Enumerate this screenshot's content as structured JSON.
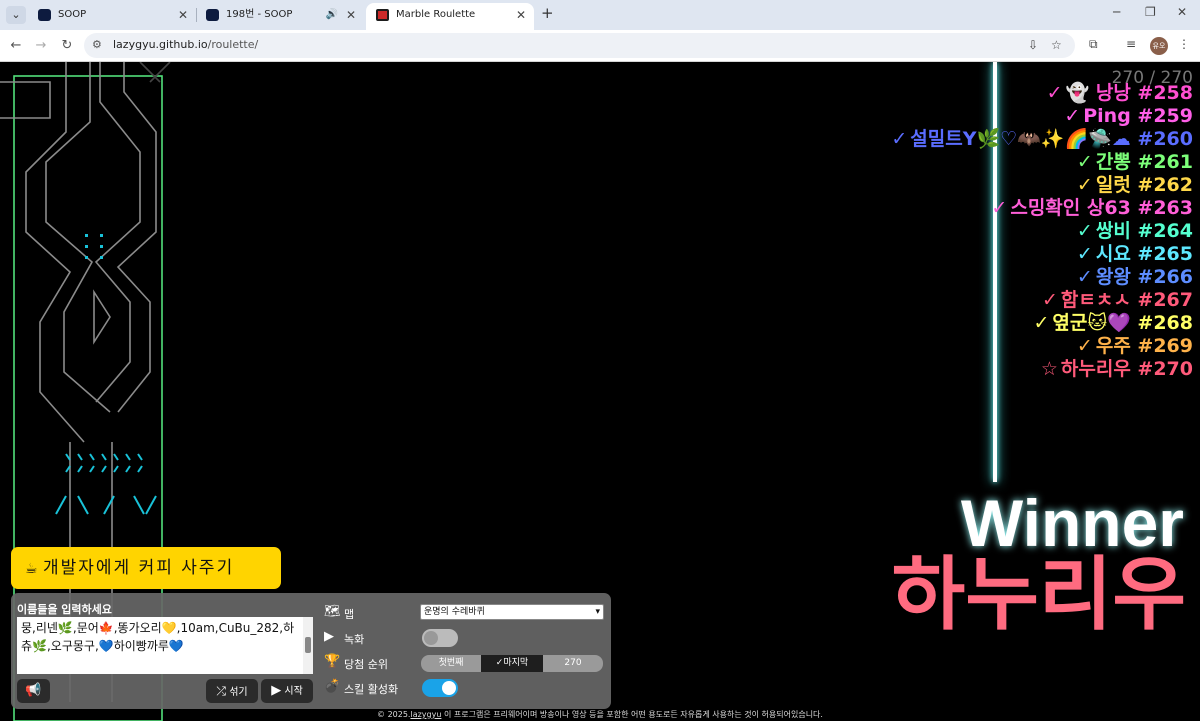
{
  "browser": {
    "tabs": [
      {
        "title": "SOOP",
        "active": false
      },
      {
        "title": "198번 - SOOP",
        "active": false,
        "audio": true
      },
      {
        "title": "Marble Roulette",
        "active": true
      }
    ],
    "url_host": "lazygyu.github.io",
    "url_path": "/roulette/",
    "avatar": "유오"
  },
  "game": {
    "counter": "270 / 270",
    "ranking": [
      {
        "mark": "✓",
        "text": "👻 낭낭 #258",
        "color": "#ff4fd1"
      },
      {
        "mark": "✓",
        "text": "Ping #259",
        "color": "#ff5fe8"
      },
      {
        "mark": "✓",
        "text": "설밀트Y🌿♡🦇✨🌈🛸☁ #260",
        "color": "#5a6dff"
      },
      {
        "mark": "✓",
        "text": "간뽕 #261",
        "color": "#7dff7a"
      },
      {
        "mark": "✓",
        "text": "일럿 #262",
        "color": "#ffd84a"
      },
      {
        "mark": "✓",
        "text": "스밍확인 상63 #263",
        "color": "#ff5fd8"
      },
      {
        "mark": "✓",
        "text": "쌍비 #264",
        "color": "#55ffd0"
      },
      {
        "mark": "✓",
        "text": "시요 #265",
        "color": "#5ee8ff"
      },
      {
        "mark": "✓",
        "text": "왕왕 #266",
        "color": "#5d8dff"
      },
      {
        "mark": "✓",
        "text": "함ㅌㅊㅅ #267",
        "color": "#ff5a7a"
      },
      {
        "mark": "✓",
        "text": "옆군🐱💜 #268",
        "color": "#ffff66"
      },
      {
        "mark": "✓",
        "text": "우주 #269",
        "color": "#ffb24a"
      },
      {
        "mark": "☆",
        "text": "하누리우 #270",
        "color": "#ff5a7a"
      }
    ],
    "winner_title": "Winner",
    "winner_name": "하누리우"
  },
  "controls": {
    "coffee_label": "개발자에게 커피 사주기",
    "names_label": "이름들을 입력하세요",
    "names_text": "뭉,리넨🌿,문어🍁,똥가오리💛,10am,CuBu_282,하츄🌿,오구몽구,💙하이빵까루💙",
    "shuffle_label": "섞기",
    "start_label": "시작",
    "map_label": "맵",
    "map_value": "운명의 수레바퀴",
    "record_label": "녹화",
    "record_on": false,
    "rank_label": "당첨 순위",
    "rank_options": [
      "첫번째",
      "✓마지막",
      "270"
    ],
    "skill_label": "스킬 활성화",
    "skill_on": true
  },
  "footer": {
    "copyright": "© 2025.",
    "author": "lazygyu",
    "notice": " 이 프로그램은 프리웨어이며 방송이나 영상 등을 포함한 어떤 용도로든 자유롭게 사용하는 것이 허용되어있습니다."
  }
}
